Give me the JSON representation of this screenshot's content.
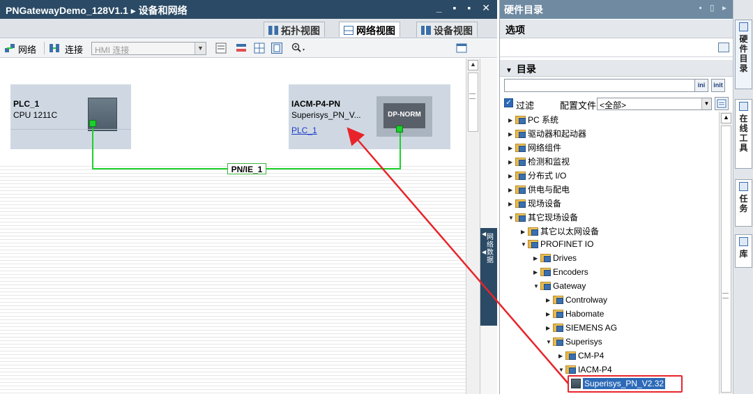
{
  "left_window": {
    "title": "PNGatewayDemo_128V1.1 ▸ 设备和网络",
    "window_buttons": "_ ▪ ▪ ✕"
  },
  "view_tabs": {
    "topology": "拓扑视图",
    "network": "网络视图",
    "device": "设备视图"
  },
  "toolbar": {
    "network": "网络",
    "connections": "连接",
    "hmi_connection": "HMI 连接"
  },
  "devices": {
    "plc": {
      "name": "PLC_1",
      "type": "CPU 1211C"
    },
    "gateway": {
      "name": "IACM-P4-PN",
      "type": "Superisys_PN_V...",
      "link": "PLC_1",
      "module_label": "DP-NORM"
    }
  },
  "network": {
    "subnet_label": "PN/IE_1"
  },
  "side_strip": {
    "label": "网络数据"
  },
  "catalog": {
    "title": "硬件目录",
    "options_header": "选项",
    "catalog_header": "目录",
    "search_value": "",
    "search_btn_1": "ini",
    "search_btn_2": "init",
    "filter_label": "过滤",
    "profile_label": "配置文件",
    "profile_value": "<全部>",
    "tree": [
      {
        "label": "PC 系统",
        "indent": 0,
        "expanded": false,
        "kind": "folder"
      },
      {
        "label": "驱动器和起动器",
        "indent": 0,
        "expanded": false,
        "kind": "folder"
      },
      {
        "label": "网络组件",
        "indent": 0,
        "expanded": false,
        "kind": "folder"
      },
      {
        "label": "检测和监视",
        "indent": 0,
        "expanded": false,
        "kind": "folder"
      },
      {
        "label": "分布式 I/O",
        "indent": 0,
        "expanded": false,
        "kind": "folder"
      },
      {
        "label": "供电与配电",
        "indent": 0,
        "expanded": false,
        "kind": "folder"
      },
      {
        "label": "现场设备",
        "indent": 0,
        "expanded": false,
        "kind": "folder"
      },
      {
        "label": "其它现场设备",
        "indent": 0,
        "expanded": true,
        "kind": "folder"
      },
      {
        "label": "其它以太网设备",
        "indent": 1,
        "expanded": false,
        "kind": "folder"
      },
      {
        "label": "PROFINET IO",
        "indent": 1,
        "expanded": true,
        "kind": "folder"
      },
      {
        "label": "Drives",
        "indent": 2,
        "expanded": false,
        "kind": "folder"
      },
      {
        "label": "Encoders",
        "indent": 2,
        "expanded": false,
        "kind": "folder"
      },
      {
        "label": "Gateway",
        "indent": 2,
        "expanded": true,
        "kind": "folder"
      },
      {
        "label": "Controlway",
        "indent": 3,
        "expanded": false,
        "kind": "folder"
      },
      {
        "label": "Habomate",
        "indent": 3,
        "expanded": false,
        "kind": "folder"
      },
      {
        "label": "SIEMENS AG",
        "indent": 3,
        "expanded": false,
        "kind": "folder"
      },
      {
        "label": "Superisys",
        "indent": 3,
        "expanded": true,
        "kind": "folder"
      },
      {
        "label": "CM-P4",
        "indent": 4,
        "expanded": false,
        "kind": "folder"
      },
      {
        "label": "IACM-P4",
        "indent": 4,
        "expanded": true,
        "kind": "folder"
      },
      {
        "label": "Superisys_PN_V2.32",
        "indent": 5,
        "expanded": null,
        "kind": "device",
        "selected": true
      }
    ]
  },
  "vertical_tabs": [
    "硬件目录",
    "在线工具",
    "任务",
    "库"
  ],
  "colors": {
    "title_dark": "#2a4a65",
    "catalog_title": "#6f8aa1",
    "network_green": "#1bd12b",
    "selection_blue": "#2c6ab8",
    "annotation_red": "#e8242a"
  }
}
